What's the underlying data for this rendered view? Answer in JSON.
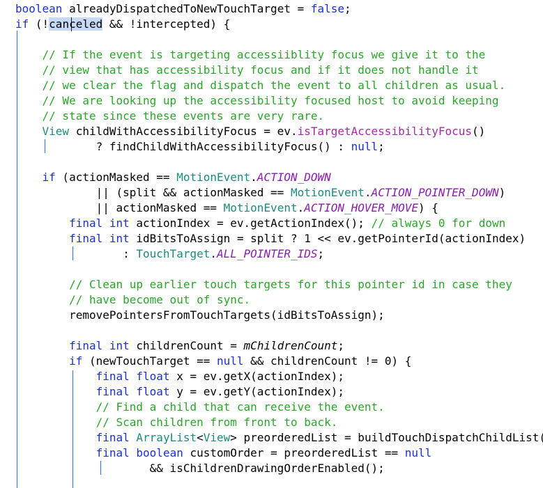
{
  "code_lines": [
    [
      {
        "t": "boolean",
        "c": "kw"
      },
      {
        "t": " alreadyDispatchedToNewTouchTarget = "
      },
      {
        "t": "false",
        "c": "kw"
      },
      {
        "t": ";"
      }
    ],
    [
      {
        "t": "if",
        "c": "kw"
      },
      {
        "t": " (!"
      },
      {
        "t": "canceled",
        "c": "sel"
      },
      {
        "t": " && !intercepted) {"
      }
    ],
    [],
    [
      {
        "t": "    "
      },
      {
        "t": "// If the event is targeting accessiiblity focus we give it to the",
        "c": "cm"
      }
    ],
    [
      {
        "t": "    "
      },
      {
        "t": "// view that has accessibility focus and if it does not handle it",
        "c": "cm"
      }
    ],
    [
      {
        "t": "    "
      },
      {
        "t": "// we clear the flag and dispatch the event to all children as usual.",
        "c": "cm"
      }
    ],
    [
      {
        "t": "    "
      },
      {
        "t": "// We are looking up the accessibility focused host to avoid keeping",
        "c": "cm"
      }
    ],
    [
      {
        "t": "    "
      },
      {
        "t": "// state since these events are very rare.",
        "c": "cm"
      }
    ],
    [
      {
        "t": "    "
      },
      {
        "t": "View",
        "c": "cls"
      },
      {
        "t": " childWithAccessibilityFocus = ev."
      },
      {
        "t": "isTargetAccessibilityFocus",
        "c": "mth"
      },
      {
        "t": "()"
      }
    ],
    [
      {
        "t": "            ? findChildWithAccessibilityFocus() : "
      },
      {
        "t": "null",
        "c": "kw"
      },
      {
        "t": ";"
      }
    ],
    [],
    [
      {
        "t": "    "
      },
      {
        "t": "if",
        "c": "kw"
      },
      {
        "t": " (actionMasked == "
      },
      {
        "t": "MotionEvent",
        "c": "cls"
      },
      {
        "t": "."
      },
      {
        "t": "ACTION_DOWN",
        "c": "st"
      }
    ],
    [
      {
        "t": "            || (split && actionMasked == "
      },
      {
        "t": "MotionEvent",
        "c": "cls"
      },
      {
        "t": "."
      },
      {
        "t": "ACTION_POINTER_DOWN",
        "c": "st"
      },
      {
        "t": ")"
      }
    ],
    [
      {
        "t": "            || actionMasked == "
      },
      {
        "t": "MotionEvent",
        "c": "cls"
      },
      {
        "t": "."
      },
      {
        "t": "ACTION_HOVER_MOVE",
        "c": "st"
      },
      {
        "t": ") {"
      }
    ],
    [
      {
        "t": "        "
      },
      {
        "t": "final",
        "c": "kw"
      },
      {
        "t": " "
      },
      {
        "t": "int",
        "c": "kw"
      },
      {
        "t": " actionIndex = ev.getActionIndex(); "
      },
      {
        "t": "// always 0 for down",
        "c": "cm"
      }
    ],
    [
      {
        "t": "        "
      },
      {
        "t": "final",
        "c": "kw"
      },
      {
        "t": " "
      },
      {
        "t": "int",
        "c": "kw"
      },
      {
        "t": " idBitsToAssign = split ? "
      },
      {
        "t": "1",
        "c": "num"
      },
      {
        "t": " << ev.getPointerId(actionIndex)"
      }
    ],
    [
      {
        "t": "                : "
      },
      {
        "t": "TouchTarget",
        "c": "cls"
      },
      {
        "t": "."
      },
      {
        "t": "ALL_POINTER_IDS",
        "c": "st"
      },
      {
        "t": ";"
      }
    ],
    [],
    [
      {
        "t": "        "
      },
      {
        "t": "// Clean up earlier touch targets for this pointer id in case they",
        "c": "cm"
      }
    ],
    [
      {
        "t": "        "
      },
      {
        "t": "// have become out of sync.",
        "c": "cm"
      }
    ],
    [
      {
        "t": "        removePointersFromTouchTargets(idBitsToAssign);"
      }
    ],
    [],
    [
      {
        "t": "        "
      },
      {
        "t": "final",
        "c": "kw"
      },
      {
        "t": " "
      },
      {
        "t": "int",
        "c": "kw"
      },
      {
        "t": " childrenCount = "
      },
      {
        "t": "mChildrenCount",
        "c": "fld"
      },
      {
        "t": ";"
      }
    ],
    [
      {
        "t": "        "
      },
      {
        "t": "if",
        "c": "kw"
      },
      {
        "t": " (newTouchTarget == "
      },
      {
        "t": "null",
        "c": "kw"
      },
      {
        "t": " && childrenCount != "
      },
      {
        "t": "0",
        "c": "num"
      },
      {
        "t": ") {"
      }
    ],
    [
      {
        "t": "            "
      },
      {
        "t": "final",
        "c": "kw"
      },
      {
        "t": " "
      },
      {
        "t": "float",
        "c": "kw"
      },
      {
        "t": " x = ev.getX(actionIndex);"
      }
    ],
    [
      {
        "t": "            "
      },
      {
        "t": "final",
        "c": "kw"
      },
      {
        "t": " "
      },
      {
        "t": "float",
        "c": "kw"
      },
      {
        "t": " y = ev.getY(actionIndex);"
      }
    ],
    [
      {
        "t": "            "
      },
      {
        "t": "// Find a child that can receive the event.",
        "c": "cm"
      }
    ],
    [
      {
        "t": "            "
      },
      {
        "t": "// Scan children from front to back.",
        "c": "cm"
      }
    ],
    [
      {
        "t": "            "
      },
      {
        "t": "final",
        "c": "kw"
      },
      {
        "t": " "
      },
      {
        "t": "ArrayList",
        "c": "cls"
      },
      {
        "t": "<"
      },
      {
        "t": "View",
        "c": "cls"
      },
      {
        "t": "> preorderedList = buildTouchDispatchChildList();"
      }
    ],
    [
      {
        "t": "            "
      },
      {
        "t": "final",
        "c": "kw"
      },
      {
        "t": " "
      },
      {
        "t": "boolean",
        "c": "kw"
      },
      {
        "t": " customOrder = preorderedList == "
      },
      {
        "t": "null",
        "c": "kw"
      }
    ],
    [
      {
        "t": "                    && isChildrenDrawingOrderEnabled();"
      }
    ]
  ]
}
